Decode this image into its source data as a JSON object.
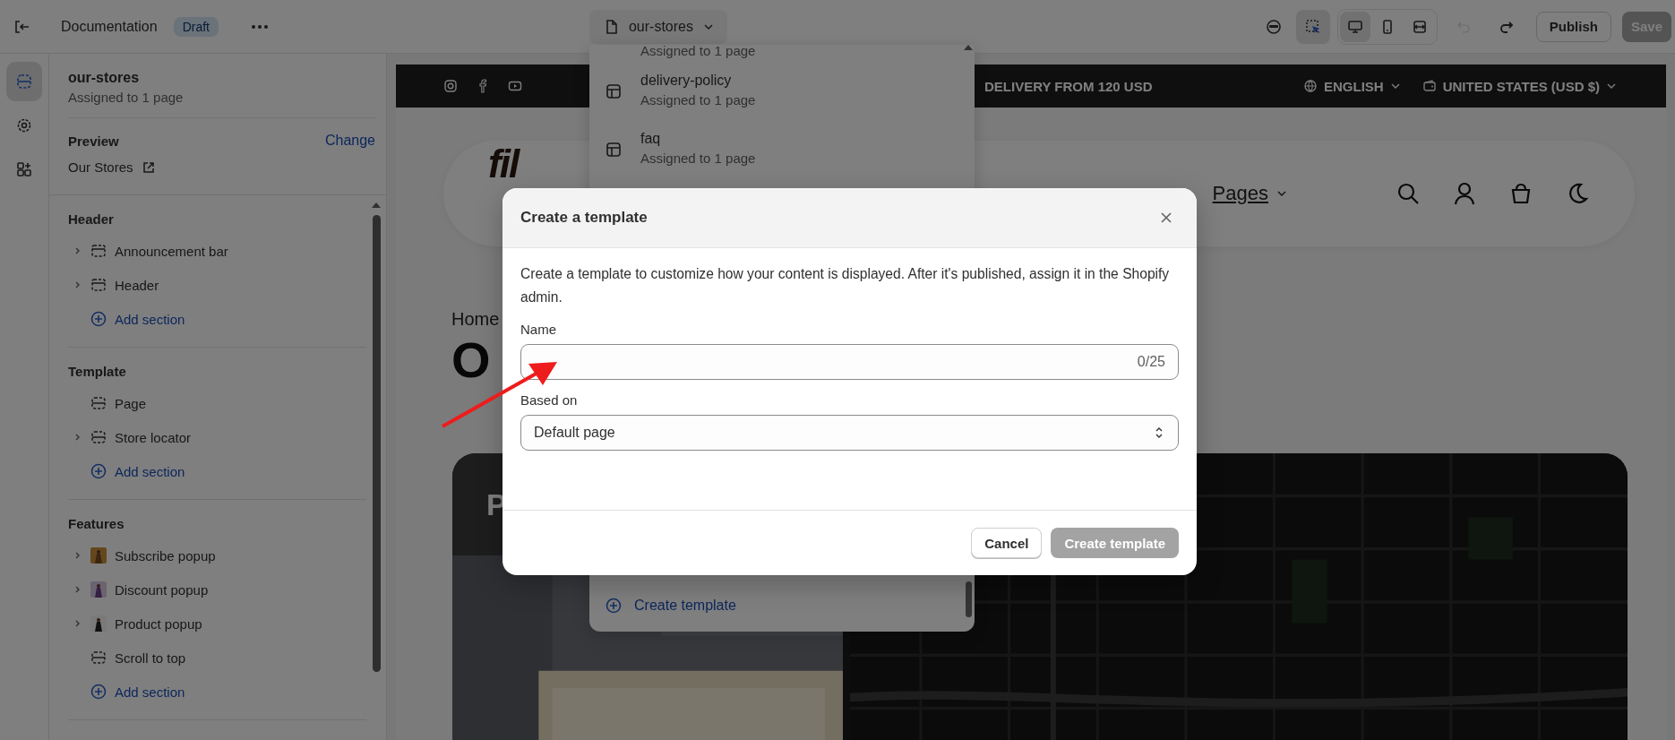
{
  "topbar": {
    "title": "Documentation",
    "status_badge": "Draft",
    "template_picker": "our-stores",
    "tools": [
      {
        "kind": "inspector",
        "selected": false
      },
      {
        "kind": "select",
        "selected": true
      }
    ],
    "devices": [
      {
        "kind": "desktop",
        "selected": true
      },
      {
        "kind": "mobile",
        "selected": false
      },
      {
        "kind": "fullwidth",
        "selected": false
      }
    ],
    "history": [
      {
        "kind": "undo",
        "disabled": true
      },
      {
        "kind": "redo",
        "disabled": false
      }
    ],
    "publish_button": "Publish",
    "save_button": {
      "label": "Save",
      "disabled": true
    }
  },
  "rail": [
    {
      "kind": "sections",
      "selected": true
    },
    {
      "kind": "settings",
      "selected": false
    },
    {
      "kind": "apps",
      "selected": false
    }
  ],
  "sidebar": {
    "template_name": "our-stores",
    "assignment": "Assigned to 1 page",
    "preview": {
      "label": "Preview",
      "change_link": "Change",
      "page": "Our Stores"
    },
    "groups": [
      {
        "title": "Header",
        "add_label": "Add section",
        "items": [
          {
            "label": "Announcement bar",
            "kind": "header",
            "expandable": true
          },
          {
            "label": "Header",
            "kind": "header",
            "expandable": true
          }
        ]
      },
      {
        "title": "Template",
        "add_label": "Add section",
        "items": [
          {
            "label": "Page",
            "kind": "section",
            "expandable": false
          },
          {
            "label": "Store locator",
            "kind": "section",
            "expandable": true
          }
        ]
      },
      {
        "title": "Features",
        "add_label": "Add section",
        "items": [
          {
            "label": "Subscribe popup",
            "expandable": true
          },
          {
            "label": "Discount popup",
            "expandable": true
          },
          {
            "label": "Product popup",
            "expandable": true
          },
          {
            "label": "Scroll to top",
            "kind": "section",
            "expandable": false
          }
        ]
      }
    ]
  },
  "template_menu": {
    "partial_item": "Assigned to 1 page",
    "items": [
      {
        "name": "delivery-policy",
        "subtitle": "Assigned to 1 page"
      },
      {
        "name": "faq",
        "subtitle": "Assigned to 1 page"
      }
    ],
    "create_link": "Create template"
  },
  "store": {
    "announcement": "DELIVERY FROM 120 USD",
    "language": "ENGLISH",
    "currency": "UNITED STATES (USD $)",
    "logo": "fil",
    "nav": [
      "Pages"
    ],
    "breadcrumb": "Home",
    "heading": "O",
    "card_heading": "P"
  },
  "dialog": {
    "title": "Create a template",
    "description": "Create a template to customize how your content is displayed. After it's published, assign it in the Shopify admin.",
    "name_label": "Name",
    "counter": "0/25",
    "based_on_label": "Based on",
    "based_on_value": "Default page",
    "cancel_button": "Cancel",
    "create_button": {
      "label": "Create template",
      "disabled": true
    }
  }
}
